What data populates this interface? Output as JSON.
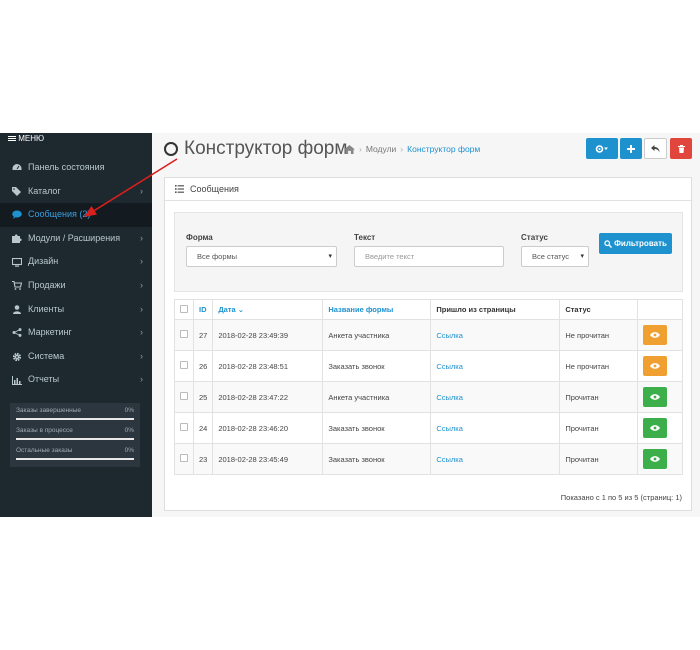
{
  "menu": {
    "title": "МЕНЮ"
  },
  "sidebar": {
    "items": [
      {
        "label": "Панель состояния",
        "icon": "dashboard-icon",
        "chevron": false,
        "active": false
      },
      {
        "label": "Каталог",
        "icon": "tags-icon",
        "chevron": true,
        "active": false
      },
      {
        "label": "Сообщения (2)",
        "icon": "comment-icon",
        "chevron": false,
        "active": true
      },
      {
        "label": "Модули / Расширения",
        "icon": "puzzle-icon",
        "chevron": true,
        "active": false
      },
      {
        "label": "Дизайн",
        "icon": "monitor-icon",
        "chevron": true,
        "active": false
      },
      {
        "label": "Продажи",
        "icon": "cart-icon",
        "chevron": true,
        "active": false
      },
      {
        "label": "Клиенты",
        "icon": "user-icon",
        "chevron": true,
        "active": false
      },
      {
        "label": "Маркетинг",
        "icon": "share-icon",
        "chevron": true,
        "active": false
      },
      {
        "label": "Система",
        "icon": "gear-icon",
        "chevron": true,
        "active": false
      },
      {
        "label": "Отчеты",
        "icon": "bar-chart-icon",
        "chevron": true,
        "active": false
      }
    ],
    "stats": [
      {
        "label": "Заказы завершенные",
        "value": "0%",
        "progress": 0
      },
      {
        "label": "Заказы в процессе",
        "value": "0%",
        "progress": 0
      },
      {
        "label": "Остальные заказы",
        "value": "0%",
        "progress": 0
      }
    ]
  },
  "header": {
    "title": "Конструктор форм",
    "breadcrumb": [
      "Модули",
      "Конструктор форм"
    ]
  },
  "panel": {
    "heading": "Сообщения",
    "filter": {
      "form_label": "Форма",
      "form_value": "Все формы",
      "text_label": "Текст",
      "text_placeholder": "Введите текст",
      "status_label": "Статус",
      "status_value": "Все статус",
      "button": "Фильтровать"
    },
    "table": {
      "headers": {
        "id": "ID",
        "date": "Дата",
        "form": "Название формы",
        "page": "Пришло из страницы",
        "status": "Статус"
      },
      "rows": [
        {
          "id": "27",
          "date": "2018-02-28 23:49:39",
          "form": "Анкета участника",
          "page": "Ссылка",
          "status": "Не прочитан",
          "read": false
        },
        {
          "id": "26",
          "date": "2018-02-28 23:48:51",
          "form": "Заказать звонок",
          "page": "Ссылка",
          "status": "Не прочитан",
          "read": false
        },
        {
          "id": "25",
          "date": "2018-02-28 23:47:22",
          "form": "Анкета участника",
          "page": "Ссылка",
          "status": "Прочитан",
          "read": true
        },
        {
          "id": "24",
          "date": "2018-02-28 23:46:20",
          "form": "Заказать звонок",
          "page": "Ссылка",
          "status": "Прочитан",
          "read": true
        },
        {
          "id": "23",
          "date": "2018-02-28 23:45:49",
          "form": "Заказать звонок",
          "page": "Ссылка",
          "status": "Прочитан",
          "read": true
        }
      ]
    },
    "pagination": "Показано с 1 по 5 из 5 (страниц: 1)"
  },
  "colors": {
    "sidebar_bg": "#1e282f",
    "accent": "#1e91cf",
    "unread": "#f0a030",
    "read": "#3cae4a",
    "delete": "#e0463b",
    "annotation_arrow": "#d8201c"
  }
}
